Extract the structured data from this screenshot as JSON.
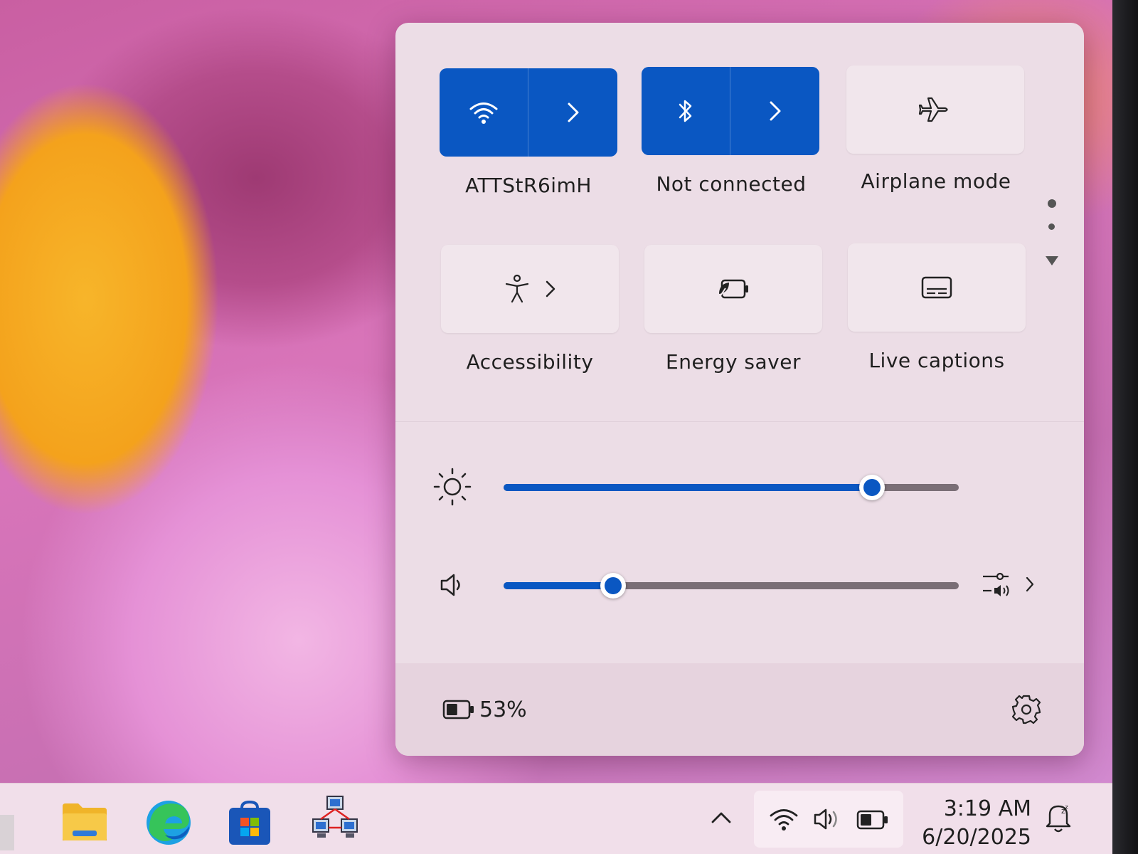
{
  "quick_settings": {
    "tiles": [
      {
        "id": "wifi",
        "label": "ATTStR6imH",
        "state": "on",
        "icon": "wifi-icon"
      },
      {
        "id": "bluetooth",
        "label": "Not connected",
        "state": "on",
        "icon": "bluetooth-icon"
      },
      {
        "id": "airplane",
        "label": "Airplane mode",
        "state": "off",
        "icon": "airplane-icon"
      },
      {
        "id": "accessibility",
        "label": "Accessibility",
        "state": "off",
        "icon": "accessibility-icon"
      },
      {
        "id": "energy",
        "label": "Energy saver",
        "state": "off",
        "icon": "energy-saver-icon"
      },
      {
        "id": "captions",
        "label": "Live captions",
        "state": "off",
        "icon": "live-captions-icon"
      }
    ],
    "brightness": {
      "value": 0.81,
      "icon": "brightness-icon"
    },
    "volume": {
      "value": 0.24,
      "icon": "speaker-icon"
    },
    "battery": {
      "percent_text": "53%",
      "level": 0.53,
      "icon": "battery-icon"
    }
  },
  "taskbar": {
    "apps": [
      "file-explorer-icon",
      "edge-icon",
      "store-icon",
      "network-app-icon"
    ],
    "clock": {
      "time": "3:19 AM",
      "date": "6/20/2025"
    }
  },
  "colors": {
    "accent": "#0a57c2",
    "panel": "#ecdde6",
    "taskbar": "#f1dfea"
  }
}
